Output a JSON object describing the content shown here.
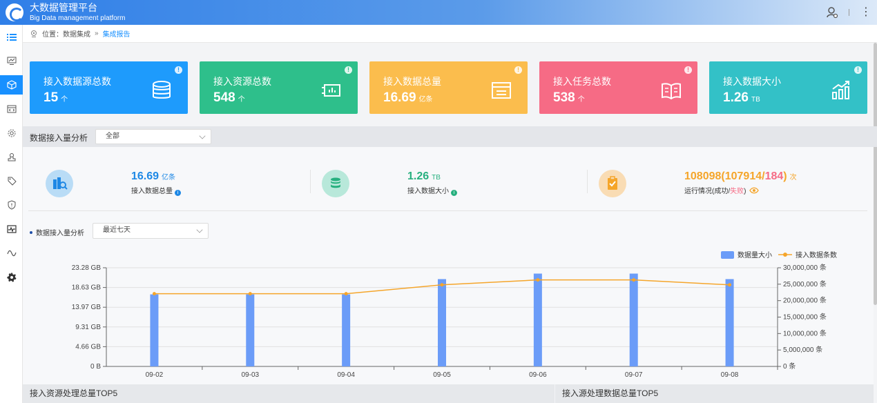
{
  "app": {
    "title": "大数据管理平台",
    "subtitle": "Big Data management platform"
  },
  "breadcrumb": {
    "prefix": "位置：",
    "parent": "数据集成",
    "current": "集成报告"
  },
  "cards": [
    {
      "title": "接入数据源总数",
      "value": "15",
      "unit": "个",
      "color": "#1e9bfc",
      "icon": "database-icon"
    },
    {
      "title": "接入资源总数",
      "value": "548",
      "unit": "个",
      "color": "#2ebf8b",
      "icon": "chip-icon"
    },
    {
      "title": "接入数据总量",
      "value": "16.69",
      "unit": "亿条",
      "color": "#fbbd4d",
      "icon": "window-icon"
    },
    {
      "title": "接入任务总数",
      "value": "538",
      "unit": "个",
      "color": "#f66b85",
      "icon": "book-icon"
    },
    {
      "title": "接入数据大小",
      "value": "1.26",
      "unit": "TB",
      "color": "#33c1c7",
      "icon": "bar-chart-icon"
    }
  ],
  "analysis": {
    "label": "数据接入量分析",
    "filter": "全部"
  },
  "stats": {
    "total": {
      "value": "16.69",
      "unit": "亿条",
      "label": "接入数据总量"
    },
    "size": {
      "value": "1.26",
      "unit": "TB",
      "label": "接入数据大小"
    },
    "run": {
      "total": "108098",
      "success": "107914",
      "fail": "184",
      "unit": "次",
      "label_main": "运行情况(成功/",
      "label_fail": "失败",
      "label_end": ")"
    }
  },
  "chart_filter": {
    "label": "数据接入量分析",
    "range": "最近七天"
  },
  "bottom": {
    "left": "接入资源处理总量TOP5",
    "right": "接入源处理数据总量TOP5"
  },
  "colors": {
    "bar": "#6b9cf8",
    "line": "#f5a52a"
  },
  "chart_data": {
    "type": "bar",
    "categories": [
      "09-02",
      "09-03",
      "09-04",
      "09-05",
      "09-06",
      "09-07",
      "09-08"
    ],
    "series": [
      {
        "name": "数据量大小",
        "type": "bar",
        "axis": "left",
        "values": [
          17.0,
          17.0,
          17.0,
          20.6,
          21.9,
          21.9,
          20.6
        ]
      },
      {
        "name": "接入数据条数",
        "type": "line",
        "axis": "right",
        "values": [
          22100000,
          22100000,
          22100000,
          24800000,
          26300000,
          26300000,
          24800000
        ]
      }
    ],
    "y_left": {
      "unit": "GB",
      "ticks": [
        "0 B",
        "4.66 GB",
        "9.31 GB",
        "13.97 GB",
        "18.63 GB",
        "23.28 GB"
      ],
      "ylim": [
        0,
        23.28
      ]
    },
    "y_right": {
      "unit": "条",
      "ticks": [
        "0 条",
        "5,000,000 条",
        "10,000,000 条",
        "15,000,000 条",
        "20,000,000 条",
        "25,000,000 条",
        "30,000,000 条"
      ],
      "ylim": [
        0,
        30000000
      ]
    },
    "legend": "top-right",
    "grid": true
  }
}
